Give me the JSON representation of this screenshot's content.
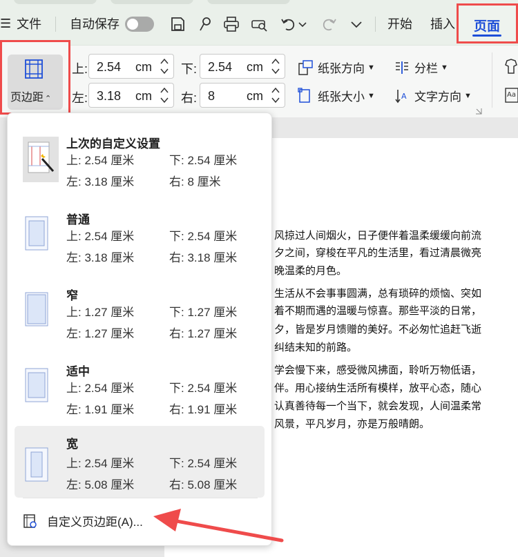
{
  "toolbar": {
    "menu_label": "文件",
    "autosave_label": "自动保存",
    "tabs": [
      {
        "label": "开始"
      },
      {
        "label": "插入"
      },
      {
        "label": "页面",
        "active": true
      }
    ]
  },
  "ribbon": {
    "margins_button_label": "页边距",
    "top_label": "上:",
    "top_value": "2.54",
    "bottom_label": "下:",
    "bottom_value": "2.54",
    "left_label": "左:",
    "left_value": "3.18",
    "right_label": "右:",
    "right_value": "8",
    "unit": "cm",
    "orientation_label": "纸张方向",
    "size_label": "纸张大小",
    "columns_label": "分栏",
    "text_direction_label": "文字方向"
  },
  "dropdown": {
    "options": [
      {
        "title": "上次的自定义设置",
        "top": "上: 2.54 厘米",
        "bottom": "下: 2.54 厘米",
        "left": "左: 3.18 厘米",
        "right": "右: 8 厘米"
      },
      {
        "title": "普通",
        "top": "上: 2.54 厘米",
        "bottom": "下: 2.54 厘米",
        "left": "左: 3.18 厘米",
        "right": "右: 3.18 厘米"
      },
      {
        "title": "窄",
        "top": "上: 1.27 厘米",
        "bottom": "下: 1.27 厘米",
        "left": "左: 1.27 厘米",
        "right": "右: 1.27 厘米"
      },
      {
        "title": "适中",
        "top": "上: 2.54 厘米",
        "bottom": "下: 2.54 厘米",
        "left": "左: 1.91 厘米",
        "right": "右: 1.91 厘米"
      },
      {
        "title": "宽",
        "top": "上: 2.54 厘米",
        "bottom": "下: 2.54 厘米",
        "left": "左: 5.08 厘米",
        "right": "右: 5.08 厘米"
      }
    ],
    "custom_label": "自定义页边距(A)..."
  },
  "document": {
    "lines": [
      "风掠过人间烟火，日子便伴着温柔缓缓向前流",
      "夕之间，穿梭在平凡的生活里，看过清晨微亮",
      "晚温柔的月色。",
      "生活从不会事事圆满，总有琐碎的烦恼、突如",
      "着不期而遇的温暖与惊喜。那些平淡的日常，",
      "夕，皆是岁月馈赠的美好。不必匆忙追赶飞逝",
      "纠结未知的前路。",
      "学会慢下来，感受微风拂面，聆听万物低语，",
      "伴。用心接纳生活所有模样，放平心态，随心",
      "认真善待每一个当下，就会发现，人间温柔常",
      "风景，平凡岁月，亦是万般晴朗。"
    ]
  },
  "colors": {
    "accent_blue": "#1d4ed8",
    "highlight_red": "#ef4b4b"
  }
}
